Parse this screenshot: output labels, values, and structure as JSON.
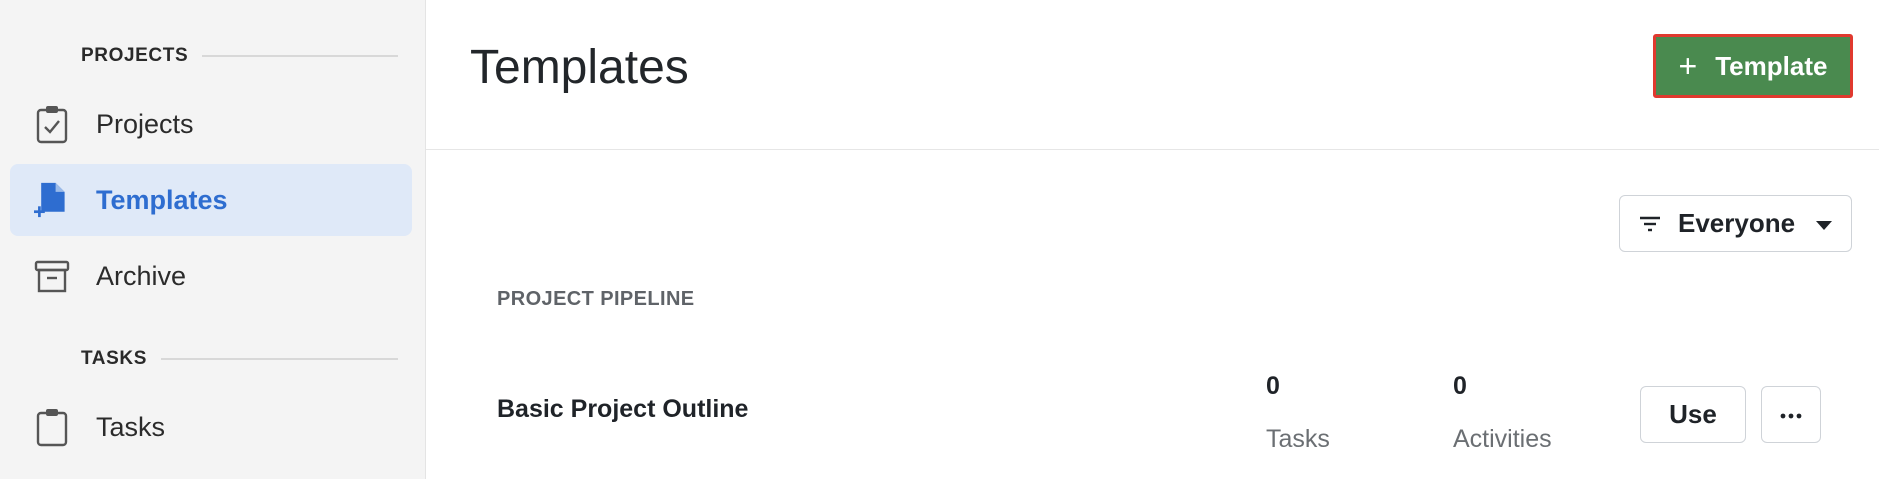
{
  "sidebar": {
    "sections": [
      {
        "label": "PROJECTS"
      },
      {
        "label": "TASKS"
      }
    ],
    "items": [
      {
        "label": "Projects",
        "icon": "clipboard-check-icon"
      },
      {
        "label": "Templates",
        "icon": "template-add-icon",
        "active": true
      },
      {
        "label": "Archive",
        "icon": "archive-box-icon"
      },
      {
        "label": "Tasks",
        "icon": "clipboard-icon"
      }
    ]
  },
  "header": {
    "title": "Templates",
    "add_button": {
      "plus": "+",
      "label": "Template"
    }
  },
  "filter": {
    "selected": "Everyone",
    "icon": "filter-icon"
  },
  "group": {
    "label": "PROJECT PIPELINE"
  },
  "templates": [
    {
      "name": "Basic Project Outline",
      "tasks_count": "0",
      "tasks_label": "Tasks",
      "activities_count": "0",
      "activities_label": "Activities",
      "use_label": "Use",
      "more_icon": "more-horizontal-icon"
    }
  ],
  "colors": {
    "accent_blue": "#2e6dd0",
    "active_bg": "#dfe9f8",
    "primary_green": "#4a8a4f",
    "highlight_border": "#e0392f"
  }
}
